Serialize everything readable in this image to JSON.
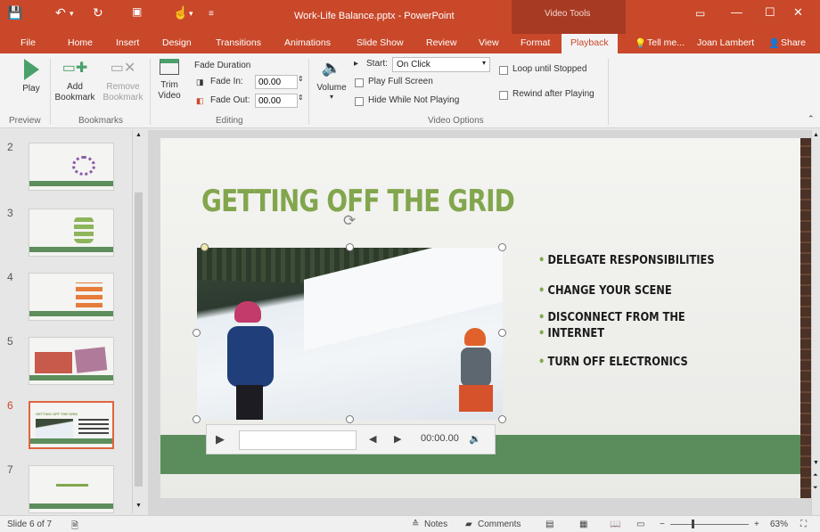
{
  "window": {
    "title": "Work-Life Balance.pptx - PowerPoint",
    "contextual_group": "Video Tools",
    "user": "Joan Lambert",
    "tell_me": "Tell me...",
    "share": "Share"
  },
  "tabs": [
    "File",
    "Home",
    "Insert",
    "Design",
    "Transitions",
    "Animations",
    "Slide Show",
    "Review",
    "View",
    "Format",
    "Playback"
  ],
  "active_tab": "Playback",
  "ribbon": {
    "preview": {
      "play": "Play",
      "group": "Preview"
    },
    "bookmarks": {
      "add": "Add Bookmark",
      "remove": "Remove Bookmark",
      "group": "Bookmarks"
    },
    "editing": {
      "trim": "Trim Video",
      "fade_duration": "Fade Duration",
      "fade_in_label": "Fade In:",
      "fade_in_value": "00.00",
      "fade_out_label": "Fade Out:",
      "fade_out_value": "00.00",
      "group": "Editing"
    },
    "video_options": {
      "volume": "Volume",
      "start_label": "Start:",
      "start_value": "On Click",
      "play_full_screen": "Play Full Screen",
      "hide_while_not_playing": "Hide While Not Playing",
      "loop_until_stopped": "Loop until Stopped",
      "rewind_after_playing": "Rewind after Playing",
      "group": "Video Options"
    }
  },
  "thumbnails": [
    {
      "num": "2",
      "title": ""
    },
    {
      "num": "3",
      "title": ""
    },
    {
      "num": "4",
      "title": ""
    },
    {
      "num": "5",
      "title": ""
    },
    {
      "num": "6",
      "title": "GETTING OFF THE GRID"
    },
    {
      "num": "7",
      "title": ""
    }
  ],
  "slide": {
    "title": "GETTING OFF THE GRID",
    "bullets": [
      "DELEGATE RESPONSIBILITIES",
      "CHANGE YOUR SCENE",
      "DISCONNECT FROM THE",
      "INTERNET",
      "TURN OFF ELECTRONICS"
    ]
  },
  "video_controls": {
    "time": "00:00.00"
  },
  "status": {
    "slide_info": "Slide 6 of 7",
    "notes": "Notes",
    "comments": "Comments",
    "zoom": "63%"
  },
  "colors": {
    "accent": "#c9482a",
    "slide_green": "#82a64d",
    "band_green": "#5a8d5b"
  }
}
